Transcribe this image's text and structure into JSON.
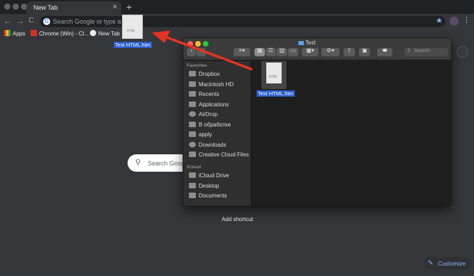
{
  "browser": {
    "tab_title": "New Tab",
    "tab_close": "×",
    "new_tab_symbol": "+",
    "back_symbol": "←",
    "forward_symbol": "→",
    "reload_symbol": "C",
    "omnibox_placeholder": "Search Google or type a URL",
    "menu_symbol": "⋮",
    "star_symbol": "★"
  },
  "bookmarks": [
    {
      "label": "Apps",
      "icon": "apps-grid-icon"
    },
    {
      "label": "Chrome (Win) - Cl...",
      "icon": "site-favicon-icon"
    },
    {
      "label": "New Tab",
      "icon": "globe-icon"
    }
  ],
  "dragged_file": {
    "label": "Test HTML.htm",
    "icon_text": "HTM"
  },
  "ntp": {
    "search_placeholder": "Search Google",
    "add_shortcut": "Add shortcut",
    "customize": "Customize"
  },
  "finder": {
    "title": "Test",
    "search_placeholder": "Search",
    "sidebar": {
      "favorites_header": "Favorites",
      "icloud_header": "iCloud",
      "favorites": [
        "Dropbox",
        "Macintosh HD",
        "Recents",
        "Applications",
        "AirDrop",
        "В обработке",
        "apply",
        "Downloads",
        "Creative Cloud Files"
      ],
      "icloud": [
        "iCloud Drive",
        "Desktop",
        "Documents"
      ]
    },
    "file": {
      "label": "Test HTML.htm",
      "icon_text": "HTM"
    }
  },
  "colors": {
    "arrow": "#e53322",
    "selection": "#2a5fd0",
    "accent": "#8ab4f8"
  }
}
